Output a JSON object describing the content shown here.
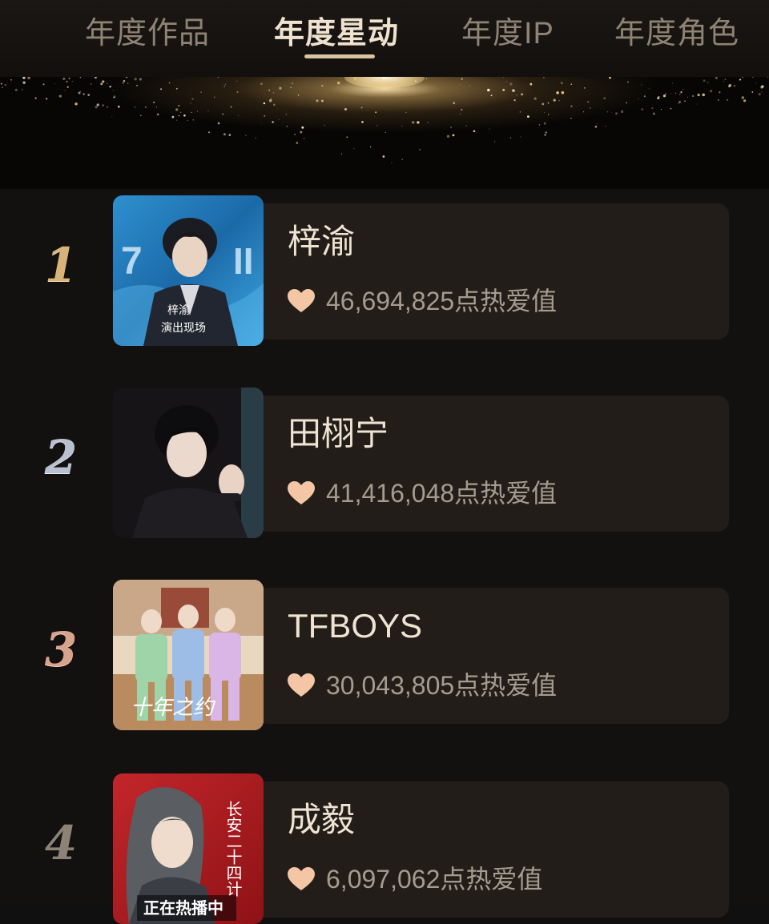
{
  "tabs": [
    {
      "label": "年度作品",
      "active": false
    },
    {
      "label": "年度星动",
      "active": true
    },
    {
      "label": "年度IP",
      "active": false
    },
    {
      "label": "年度角色",
      "active": false
    }
  ],
  "colors": {
    "accent_gold": "#d9c3a0",
    "card_bg": "#221d19",
    "heart": "#f4c6a6"
  },
  "ranking": [
    {
      "rank": "1",
      "name": "梓渝",
      "score": "46,694,825",
      "unit": "点热爱值",
      "rank_style": "gold",
      "thumb_caption": [
        "梓渝",
        "演出现场"
      ],
      "thumb_logo": "7",
      "thumb_logo_end": "II"
    },
    {
      "rank": "2",
      "name": "田栩宁",
      "score": "41,416,048",
      "unit": "点热爱值",
      "rank_style": "silver"
    },
    {
      "rank": "3",
      "name": "TFBOYS",
      "score": "30,043,805",
      "unit": "点热爱值",
      "rank_style": "bronze",
      "thumb_caption": [
        "十年之约"
      ]
    },
    {
      "rank": "4",
      "name": "成毅",
      "score": "6,097,062",
      "unit": "点热爱值",
      "rank_style": "plain",
      "thumb_caption": [
        "正在热播中"
      ],
      "thumb_title": "长安二十四计"
    }
  ]
}
